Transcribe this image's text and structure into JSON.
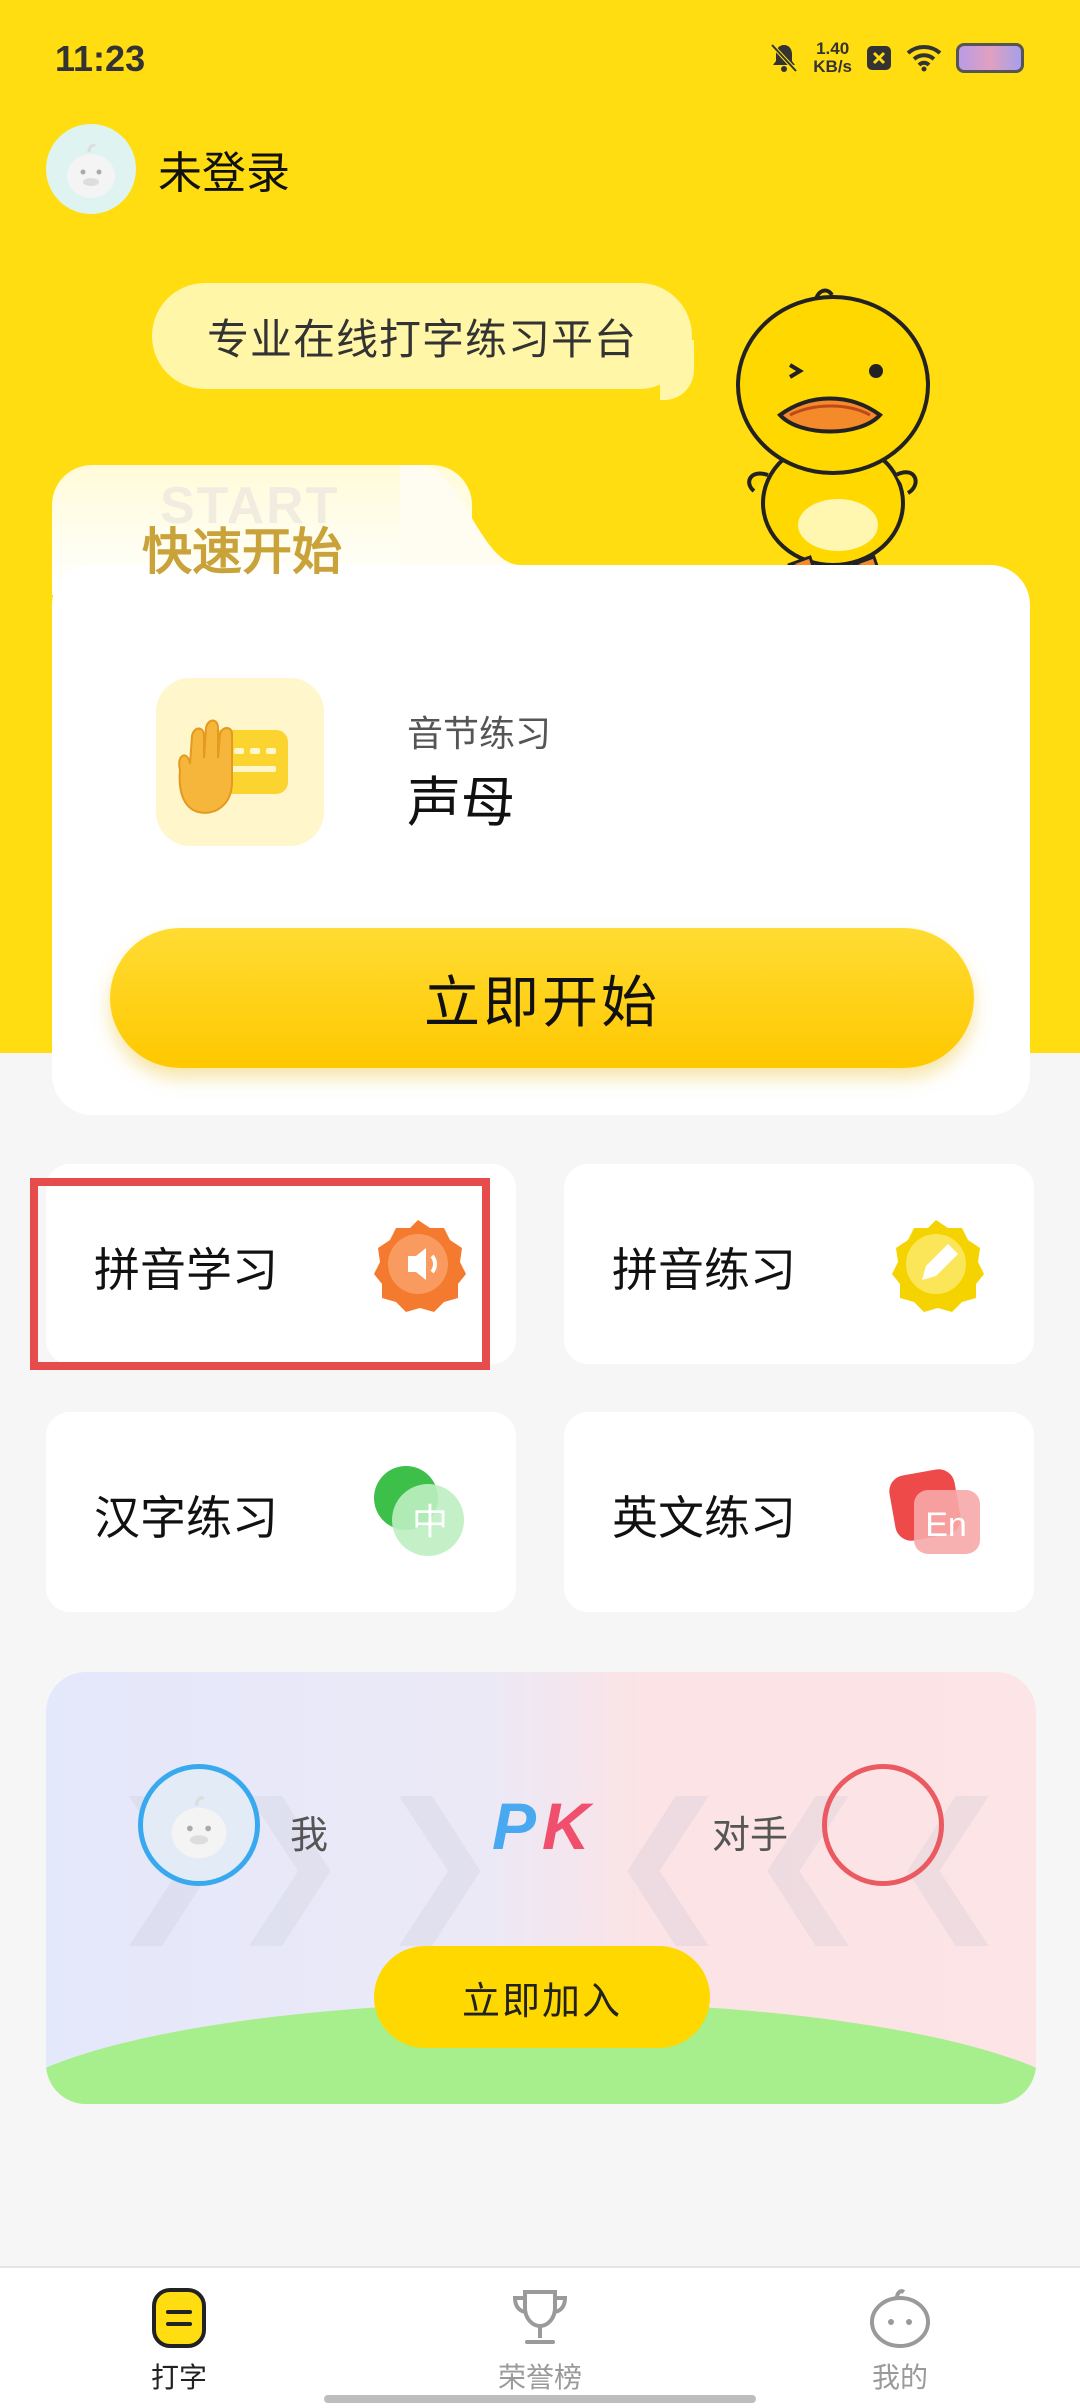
{
  "status_bar": {
    "time": "11:23",
    "net_speed_value": "1.40",
    "net_speed_unit": "KB/s"
  },
  "user": {
    "name": "未登录"
  },
  "bubble": {
    "text": "专业在线打字练习平台"
  },
  "quick_start": {
    "bg_text": "START",
    "title": "快速开始",
    "lesson_category": "音节练习",
    "lesson_name": "声母",
    "start_button": "立即开始"
  },
  "grid": {
    "items": [
      {
        "label": "拼音学习",
        "icon": "speaker-icon",
        "color": "#f47a30"
      },
      {
        "label": "拼音练习",
        "icon": "pencil-icon",
        "color": "#f5d300"
      },
      {
        "label": "汉字练习",
        "icon": "zhong-char-icon",
        "color": "#3cc04a"
      },
      {
        "label": "英文练习",
        "icon": "en-icon",
        "color": "#ef4a4a"
      }
    ],
    "zhong_char": "中",
    "en_text": "En"
  },
  "pk": {
    "me_label": "我",
    "pk_p": "P",
    "pk_k": "K",
    "opponent_label": "对手",
    "join_button": "立即加入"
  },
  "nav": {
    "items": [
      {
        "label": "打字",
        "icon": "typing-icon",
        "active": true
      },
      {
        "label": "荣誉榜",
        "icon": "trophy-icon",
        "active": false
      },
      {
        "label": "我的",
        "icon": "profile-icon",
        "active": false
      }
    ]
  },
  "colors": {
    "brand_yellow": "#ffdd10",
    "highlight_red": "#e64c4c",
    "pk_blue": "#48a8f0",
    "pk_red": "#f0506e"
  }
}
